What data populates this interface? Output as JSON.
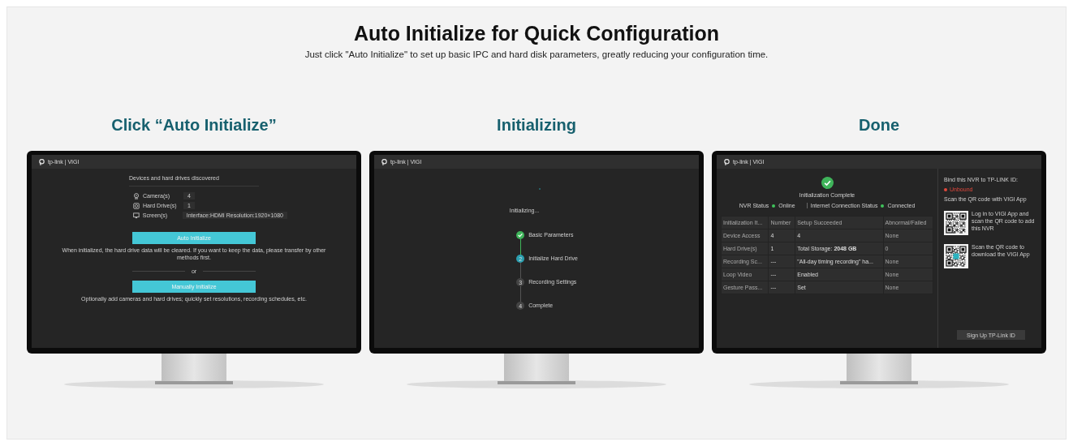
{
  "header": {
    "title": "Auto Initialize for Quick Configuration",
    "subtitle": "Just click \"Auto Initialize\" to set up basic IPC and hard disk parameters, greatly reducing your configuration time."
  },
  "steps": [
    {
      "title": "Click “Auto Initialize”",
      "screen": {
        "kind": "discover",
        "logo": "tp-link | VIGI",
        "heading": "Devices and hard drives discovered",
        "devices": [
          {
            "kind": "camera",
            "label": "Camera(s)",
            "value": "4"
          },
          {
            "kind": "drive",
            "label": "Hard Drive(s)",
            "value": "1"
          },
          {
            "kind": "screen",
            "label": "Screen(s)",
            "value": "Interface:HDMI Resolution:1920×1080"
          }
        ],
        "auto_button": "Auto Initialize",
        "warning": "When initialized, the hard drive data will be cleared. If you want to keep the data, please transfer by other methods first.",
        "separator": "or",
        "manual_button": "Manually Initialize",
        "note": "Optionally add cameras and hard drives; quickly set resolutions, recording schedules, etc."
      }
    },
    {
      "title": "Initializing",
      "screen": {
        "kind": "progress",
        "logo": "tp-link | VIGI",
        "status": "Initializing...",
        "progress": [
          {
            "label": "Basic Parameters",
            "done": true
          },
          {
            "number": "2",
            "label": "Initialize Hard Drive",
            "done": false
          },
          {
            "number": "3",
            "label": "Recording Settings",
            "done": false
          },
          {
            "number": "4",
            "label": "Complete",
            "done": false
          }
        ]
      }
    },
    {
      "title": "Done",
      "screen": {
        "kind": "done",
        "logo": "tp-link | VIGI",
        "message": "Initialization Complete",
        "statuses": [
          {
            "label": "NVR Status",
            "value": "Online",
            "color": "#3fc35b"
          },
          {
            "label": "Internet Connection Status",
            "value": "Connected",
            "color": "#3fc35b"
          }
        ],
        "table": {
          "columns": [
            "Initialization It...",
            "Number",
            "Setup Succeeded",
            "Abnormal/Failed"
          ],
          "rows": [
            [
              "Device Access",
              "4",
              "4",
              "None"
            ],
            [
              "Hard Drive(s)",
              "1",
              "Total Storage: **2048 GB**",
              "0"
            ],
            [
              "Recording Sc...",
              "---",
              "\"All-day timing recording\" ha...",
              "None"
            ],
            [
              "Loop Video",
              "---",
              "Enabled",
              "None"
            ],
            [
              "Gesture Pass...",
              "---",
              "Set",
              "None"
            ]
          ]
        },
        "bind_label": "Bind this NVR to TP-LINK ID:",
        "binding": {
          "label": "Unbound",
          "color": "#e2483c"
        },
        "scan_label": "Scan the QR code with VIGI App",
        "qr_codes": [
          {
            "kind": "plain",
            "text": "Log in to VIGI App and scan the QR code to add this NVR"
          },
          {
            "kind": "app",
            "text": "Scan the QR code to download the VIGI App"
          }
        ],
        "signup_button": "Sign Up TP-Link ID"
      }
    }
  ]
}
